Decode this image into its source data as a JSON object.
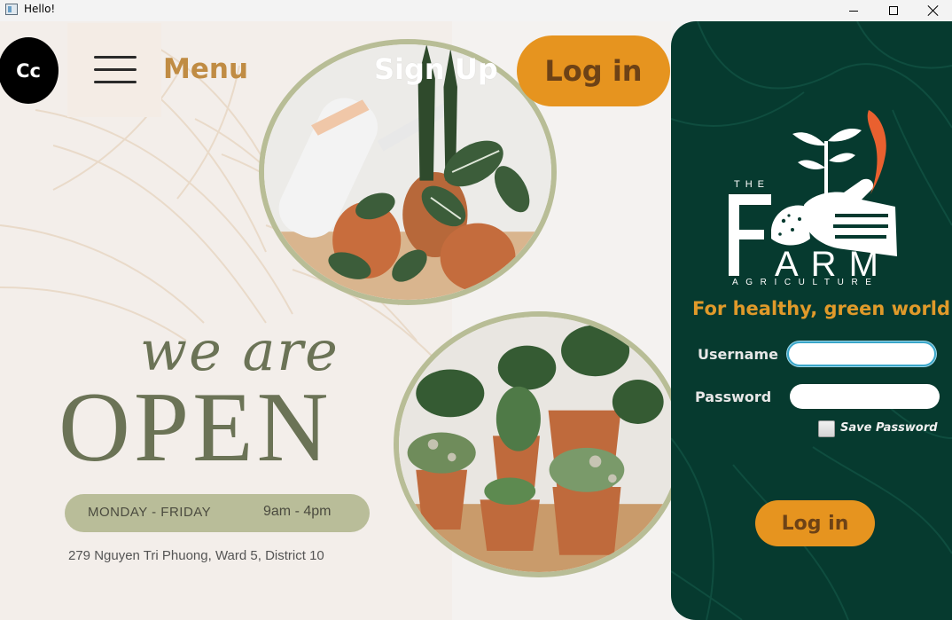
{
  "window": {
    "title": "Hello!"
  },
  "nav": {
    "logo_text": "Cc",
    "menu_label": "Menu",
    "signup_label": "Sign Up",
    "login_label": "Log in"
  },
  "poster": {
    "headline_small": "we are",
    "headline_big": "OPEN",
    "days": "MONDAY - FRIDAY",
    "hours": "9am - 4pm",
    "address": "279 Nguyen Tri Phuong, Ward 5, District 10"
  },
  "login_panel": {
    "brand_the": "THE",
    "brand_f": "F",
    "brand_arm": "ARM",
    "brand_sub": "AGRICULTURE",
    "tagline": "For healthy, green world",
    "username_label": "Username",
    "username_value": "",
    "password_label": "Password",
    "password_value": "",
    "save_password_label": "Save Password",
    "save_password_checked": false,
    "login_button": "Log in"
  },
  "colors": {
    "accent_orange": "#e6941f",
    "panel_green": "#063a2f",
    "olive_text": "#6b7356",
    "menu_gold": "#c08c44"
  }
}
